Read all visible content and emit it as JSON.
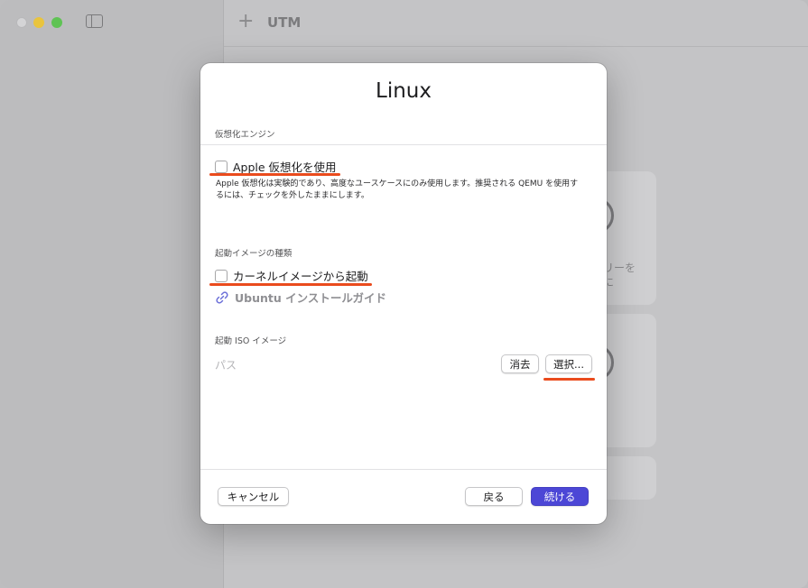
{
  "window": {
    "title": "UTM",
    "add_icon": "plus-icon"
  },
  "background": {
    "card1_text_line1": "リーを",
    "card1_text_line2": "に"
  },
  "modal": {
    "title": "Linux",
    "section_engine": {
      "heading": "仮想化エンジン",
      "checkbox_label": "Apple 仮想化を使用",
      "checked": false,
      "description": "Apple 仮想化は実験的であり、高度なユースケースにのみ使用します。推奨される QEMU を使用するには、チェックを外したままにします。"
    },
    "section_boot_type": {
      "heading": "起動イメージの種類",
      "checkbox_label": "カーネルイメージから起動",
      "checked": false,
      "link_label": "Ubuntu インストールガイド",
      "link_icon": "link-icon"
    },
    "section_iso": {
      "heading": "起動 ISO イメージ",
      "path_placeholder": "パス",
      "clear_label": "消去",
      "browse_label": "選択..."
    },
    "footer": {
      "cancel_label": "キャンセル",
      "back_label": "戻る",
      "continue_label": "続ける"
    }
  },
  "colors": {
    "accent": "#4c47d6",
    "annotation": "#ea4b1d"
  }
}
